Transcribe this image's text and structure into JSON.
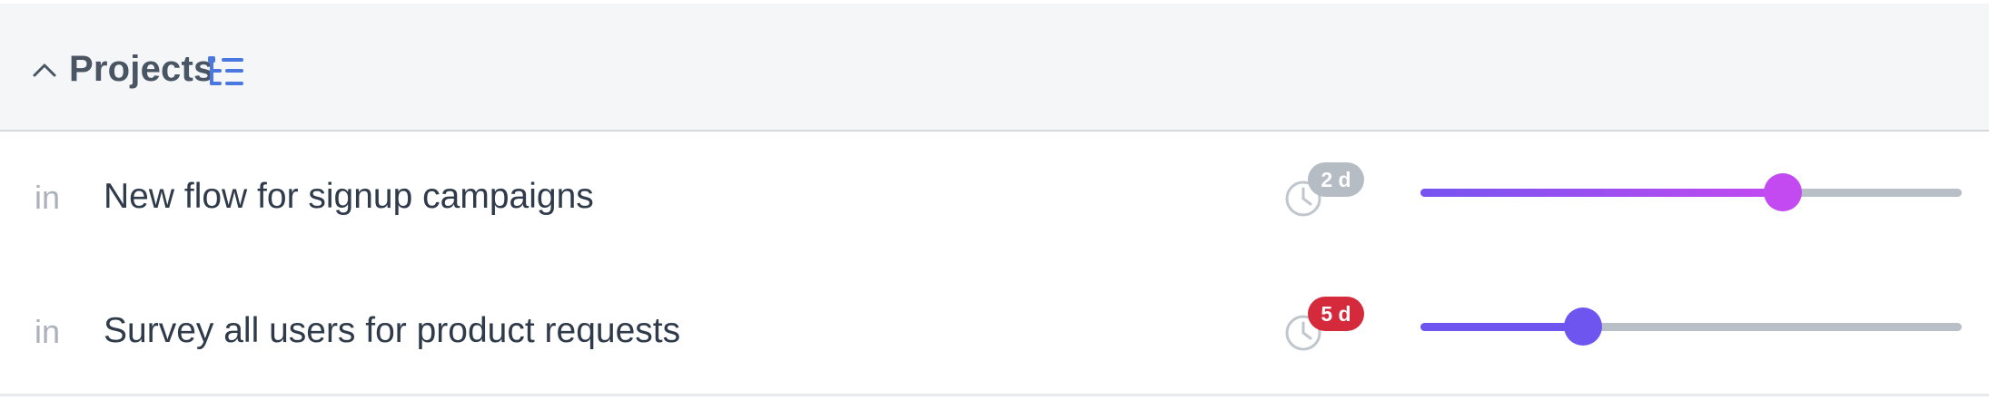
{
  "header": {
    "title": "Projects",
    "collapse_icon": "chevron-up-icon",
    "view_icon": "list-tree-icon",
    "accent_color": "#4a78e0"
  },
  "rows": [
    {
      "prefix": "in",
      "title": "New flow for signup campaigns",
      "due_badge": "2 d",
      "badge_color": "#b6bcc4",
      "progress_percent": 67,
      "progress_colors": [
        "#7654f0",
        "#c24af0"
      ]
    },
    {
      "prefix": "in",
      "title": "Survey all users for product requests",
      "due_badge": "5 d",
      "badge_color": "#d42a3c",
      "progress_percent": 30,
      "progress_colors": [
        "#6e55f0",
        "#6e55f0"
      ]
    }
  ]
}
